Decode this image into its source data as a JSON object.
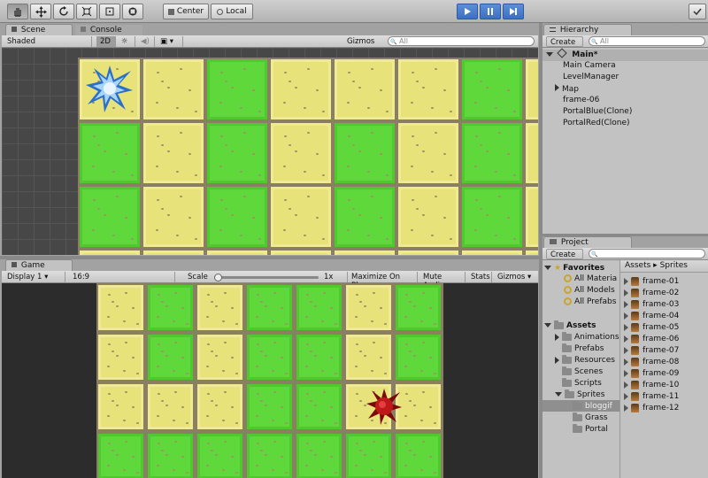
{
  "toolbar": {
    "tools": [
      "hand-tool-icon",
      "move-tool-icon",
      "rotate-tool-icon",
      "scale-tool-icon",
      "rect-tool-icon",
      "transform-tool-icon"
    ],
    "pivot_label": "Center",
    "space_label": "Local"
  },
  "scene": {
    "tab_scene": "Scene",
    "tab_console": "Console",
    "shading": "Shaded",
    "mode_2d": "2D",
    "gizmos": "Gizmos",
    "search_placeholder": "All",
    "rows": [
      [
        "s",
        "s",
        "g",
        "s",
        "s",
        "s",
        "g",
        "s"
      ],
      [
        "g",
        "s",
        "g",
        "s",
        "g",
        "s",
        "g",
        "s"
      ],
      [
        "g",
        "s",
        "g",
        "s",
        "g",
        "s",
        "g",
        "s"
      ],
      [
        "s",
        "s",
        "s",
        "s",
        "s",
        "s",
        "s",
        "s"
      ]
    ]
  },
  "game": {
    "tab": "Game",
    "display": "Display 1",
    "aspect": "16:9",
    "scale_label": "Scale",
    "scale_value": "1x",
    "scale_fraction": 0.0,
    "maximize": "Maximize On Play",
    "mute": "Mute Audio",
    "stats": "Stats",
    "gizmos": "Gizmos",
    "rows": [
      [
        "s",
        "g",
        "s",
        "g",
        "g",
        "s",
        "g"
      ],
      [
        "s",
        "g",
        "s",
        "g",
        "g",
        "s",
        "g"
      ],
      [
        "s",
        "s",
        "s",
        "g",
        "g",
        "s",
        "s"
      ],
      [
        "g",
        "g",
        "g",
        "g",
        "g",
        "g",
        "g"
      ]
    ]
  },
  "hierarchy": {
    "tab": "Hierarchy",
    "create": "Create",
    "search_placeholder": "All",
    "scene_name": "Main*",
    "items": [
      "Main Camera",
      "LevelManager",
      "Map",
      "frame-06",
      "PortalBlue(Clone)",
      "PortalRed(Clone)"
    ]
  },
  "project": {
    "tab": "Project",
    "create": "Create",
    "favorites_label": "Favorites",
    "favorites": [
      "All Materia",
      "All Models",
      "All Prefabs"
    ],
    "assets_label": "Assets",
    "folders": [
      "Animations",
      "Prefabs",
      "Resources",
      "Scenes",
      "Scripts",
      "Sprites"
    ],
    "sprite_folders": [
      "bloggif",
      "Grass",
      "Portal"
    ],
    "breadcrumb": [
      "Assets",
      "Sprites"
    ],
    "files": [
      "frame-01",
      "frame-02",
      "frame-03",
      "frame-04",
      "frame-05",
      "frame-06",
      "frame-07",
      "frame-08",
      "frame-09",
      "frame-10",
      "frame-11",
      "frame-12"
    ]
  }
}
